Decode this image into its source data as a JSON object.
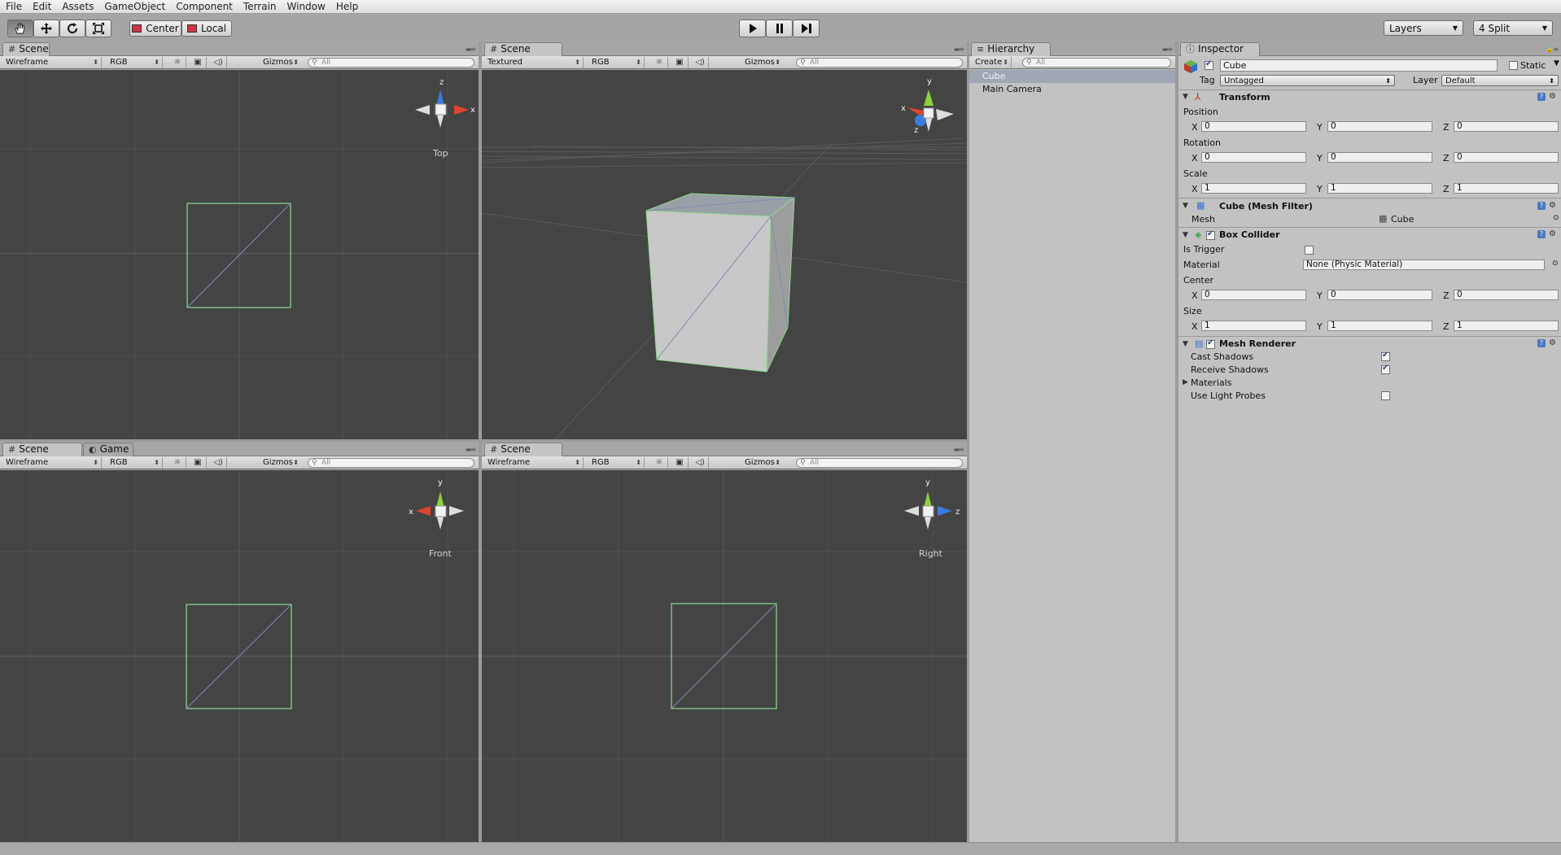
{
  "menu": [
    "File",
    "Edit",
    "Assets",
    "GameObject",
    "Component",
    "Terrain",
    "Window",
    "Help"
  ],
  "toolbar": {
    "tools": [
      "hand-icon",
      "move-icon",
      "rotate-icon",
      "scale-icon"
    ],
    "pivot_label": "Center",
    "space_label": "Local",
    "play": [
      "play-icon",
      "pause-icon",
      "step-icon"
    ],
    "layers_label": "Layers",
    "layout_label": "4 Split"
  },
  "scene_top_left": {
    "tabs": [
      "Scene"
    ],
    "render_mode": "Wireframe",
    "color_mode": "RGB",
    "gizmos": "Gizmos",
    "search_placeholder": "All",
    "view_label": "Top",
    "axes": [
      "z",
      "x"
    ]
  },
  "scene_top_right": {
    "tabs": [
      "Scene"
    ],
    "render_mode": "Textured",
    "color_mode": "RGB",
    "gizmos": "Gizmos",
    "search_placeholder": "All",
    "axes": [
      "y",
      "x",
      "z"
    ]
  },
  "scene_bottom_left": {
    "tabs": [
      "Scene",
      "Game"
    ],
    "render_mode": "Wireframe",
    "color_mode": "RGB",
    "gizmos": "Gizmos",
    "search_placeholder": "All",
    "view_label": "Front",
    "axes": [
      "y",
      "x"
    ]
  },
  "scene_bottom_right": {
    "tabs": [
      "Scene"
    ],
    "render_mode": "Wireframe",
    "color_mode": "RGB",
    "gizmos": "Gizmos",
    "search_placeholder": "All",
    "view_label": "Right",
    "axes": [
      "y",
      "z"
    ]
  },
  "hierarchy": {
    "tab": "Hierarchy",
    "create_label": "Create",
    "search_placeholder": "All",
    "items": [
      "Cube",
      "Main Camera"
    ]
  },
  "inspector": {
    "tab": "Inspector",
    "object_name": "Cube",
    "static_label": "Static",
    "tag_label": "Tag",
    "tag_value": "Untagged",
    "layer_label": "Layer",
    "layer_value": "Default",
    "transform": {
      "title": "Transform",
      "position_label": "Position",
      "rotation_label": "Rotation",
      "scale_label": "Scale",
      "position": {
        "x": "0",
        "y": "0",
        "z": "0"
      },
      "rotation": {
        "x": "0",
        "y": "0",
        "z": "0"
      },
      "scale": {
        "x": "1",
        "y": "1",
        "z": "1"
      }
    },
    "mesh_filter": {
      "title": "Cube (Mesh Filter)",
      "mesh_label": "Mesh",
      "mesh_value": "Cube"
    },
    "box_collider": {
      "title": "Box Collider",
      "is_trigger_label": "Is Trigger",
      "material_label": "Material",
      "material_value": "None (Physic Material)",
      "center_label": "Center",
      "size_label": "Size",
      "center": {
        "x": "0",
        "y": "0",
        "z": "0"
      },
      "size": {
        "x": "1",
        "y": "1",
        "z": "1"
      }
    },
    "mesh_renderer": {
      "title": "Mesh Renderer",
      "cast_shadows_label": "Cast Shadows",
      "receive_shadows_label": "Receive Shadows",
      "materials_label": "Materials",
      "use_light_probes_label": "Use Light Probes"
    },
    "axis_labels": {
      "x": "X",
      "y": "Y",
      "z": "Z"
    }
  },
  "colors": {
    "viewport_bg": "#444444",
    "wire_green": "#8fd98f",
    "axis_x": "#e0432b",
    "axis_y": "#8cd23c",
    "axis_z": "#3a7be0",
    "panel_bg": "#c2c2c2"
  }
}
